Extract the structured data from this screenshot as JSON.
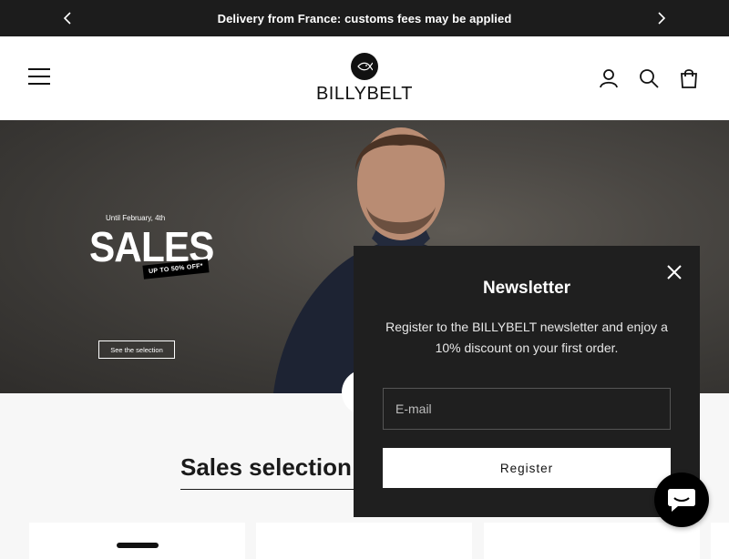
{
  "announcement": {
    "message": "Delivery from France: customs fees may be applied",
    "prev_icon": "chevron-left-icon",
    "next_icon": "chevron-right-icon"
  },
  "header": {
    "menu_icon": "hamburger-menu-icon",
    "logo_text": "BILLYBELT",
    "account_icon": "user-icon",
    "search_icon": "search-icon",
    "cart_icon": "shopping-bag-icon"
  },
  "hero": {
    "until": "Until February, 4th",
    "title": "SALES",
    "tag": "UP TO 50% OFF*",
    "cta": "See the selection"
  },
  "section": {
    "title": "Sales selection"
  },
  "newsletter": {
    "title": "Newsletter",
    "description": "Register to the BILLYBELT newsletter and enjoy a 10% discount on your first order.",
    "email_placeholder": "E-mail",
    "register_label": "Register",
    "close_icon": "close-icon"
  },
  "chat": {
    "icon": "chat-bubble-icon"
  },
  "colors": {
    "announcement_bg": "#1c1c1c",
    "popup_bg": "#1f1f1f",
    "accent": "#000000"
  }
}
